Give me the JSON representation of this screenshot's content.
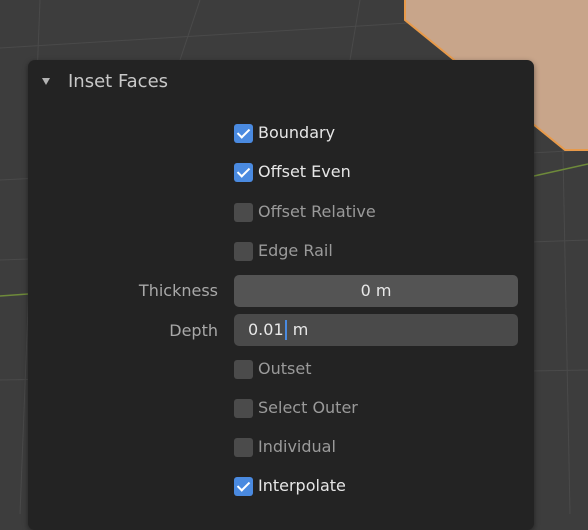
{
  "panel": {
    "title": "Inset Faces",
    "options": [
      {
        "label": "Boundary",
        "checked": true
      },
      {
        "label": "Offset Even",
        "checked": true
      },
      {
        "label": "Offset Relative",
        "checked": false
      },
      {
        "label": "Edge Rail",
        "checked": false
      }
    ],
    "thickness": {
      "label": "Thickness",
      "value": "0 m"
    },
    "depth": {
      "label": "Depth",
      "value_before_caret": "0.01",
      "value_after_caret": " m"
    },
    "options2": [
      {
        "label": "Outset",
        "checked": false
      },
      {
        "label": "Select Outer",
        "checked": false
      },
      {
        "label": "Individual",
        "checked": false
      },
      {
        "label": "Interpolate",
        "checked": true
      }
    ]
  },
  "colors": {
    "accent": "#4a8ae0",
    "panel_bg": "#232323",
    "viewport_bg": "#3d3d3d",
    "mesh_face": "#c8a58a",
    "mesh_edge": "#e89a4a"
  },
  "icons": {
    "collapse": "triangle-down-icon",
    "checkbox_checked": "checkmark-icon"
  }
}
